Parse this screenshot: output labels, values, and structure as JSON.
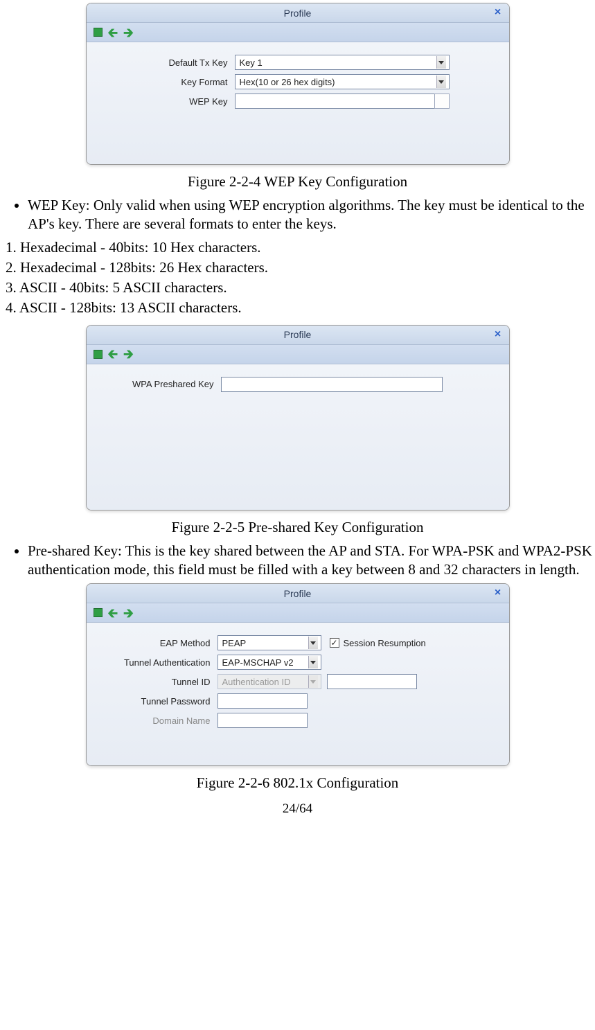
{
  "page_number": "24/64",
  "dialog1": {
    "title": "Profile",
    "fields": {
      "default_tx_key_label": "Default Tx Key",
      "default_tx_key_value": "Key 1",
      "key_format_label": "Key Format",
      "key_format_value": "Hex(10 or 26 hex digits)",
      "wep_key_label": "WEP Key",
      "wep_key_value": ""
    },
    "caption": "Figure 2-2-4 WEP Key Configuration"
  },
  "bullet1": "WEP Key: Only valid when using WEP encryption algorithms. The key must be identical to the AP's key. There are several formats to enter the keys.",
  "num_list": {
    "n1": "1. Hexadecimal - 40bits: 10 Hex characters.",
    "n2": "2. Hexadecimal - 128bits: 26 Hex characters.",
    "n3": "3. ASCII - 40bits: 5 ASCII characters.",
    "n4": "4. ASCII - 128bits: 13 ASCII characters."
  },
  "dialog2": {
    "title": "Profile",
    "fields": {
      "psk_label": "WPA Preshared Key",
      "psk_value": ""
    },
    "caption": "Figure 2-2-5 Pre-shared Key Configuration"
  },
  "bullet2": "Pre-shared Key: This is the key shared between the AP and STA. For WPA-PSK and WPA2-PSK authentication mode, this field must be filled with a key between 8 and 32 characters in length.",
  "dialog3": {
    "title": "Profile",
    "fields": {
      "eap_method_label": "EAP Method",
      "eap_method_value": "PEAP",
      "session_resumption_label": "Session Resumption",
      "session_resumption_checked": true,
      "tunnel_auth_label": "Tunnel Authentication",
      "tunnel_auth_value": "EAP-MSCHAP v2",
      "tunnel_id_label": "Tunnel ID",
      "tunnel_id_value": "Authentication ID",
      "tunnel_password_label": "Tunnel Password",
      "tunnel_password_value": "",
      "domain_name_label": "Domain Name",
      "domain_name_value": ""
    },
    "caption": "Figure 2-2-6 802.1x Configuration"
  }
}
